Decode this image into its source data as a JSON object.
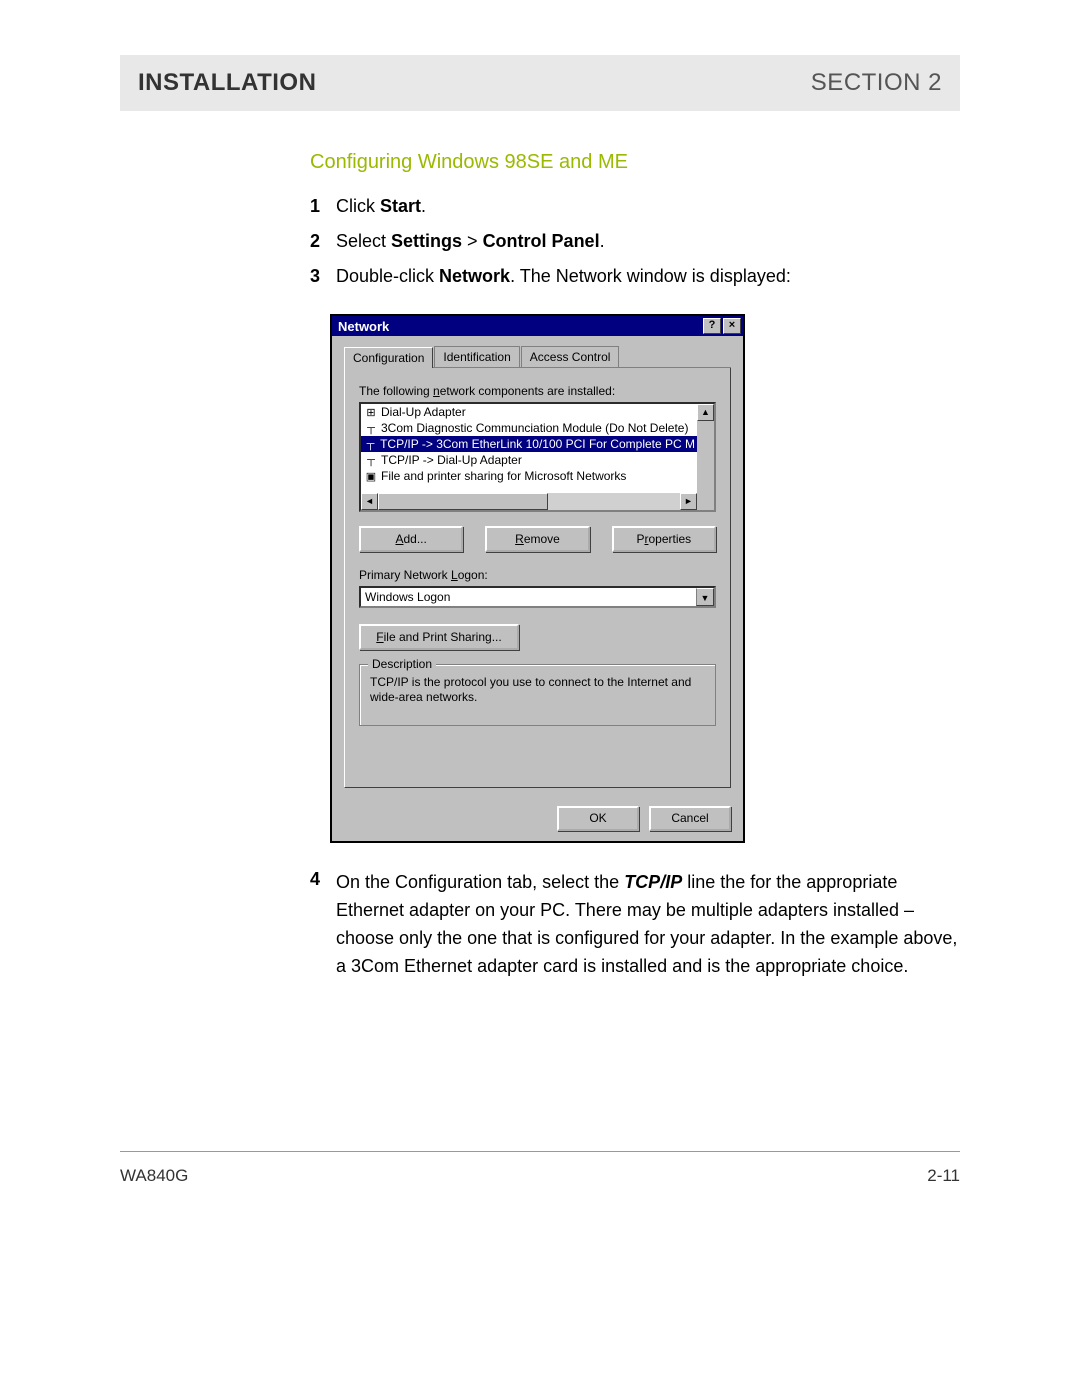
{
  "header": {
    "left": "INSTALLATION",
    "right": "SECTION 2"
  },
  "subheading": "Configuring Windows 98SE and ME",
  "steps": {
    "s1_num": "1",
    "s1_a": "Click ",
    "s1_b": "Start",
    "s1_c": ".",
    "s2_num": "2",
    "s2_a": "Select ",
    "s2_b": "Settings",
    "s2_c": " > ",
    "s2_d": "Control Panel",
    "s2_e": ".",
    "s3_num": "3",
    "s3_a": "Double-click ",
    "s3_b": "Network",
    "s3_c": ". The Network window is displayed:"
  },
  "dialog": {
    "title": "Network",
    "help_btn": "?",
    "close_btn": "×",
    "tabs": {
      "t1": "Configuration",
      "t2": "Identification",
      "t3": "Access Control"
    },
    "components_label_a": "The following ",
    "components_label_u": "n",
    "components_label_b": "etwork components are installed:",
    "list": {
      "i0": "Dial-Up Adapter",
      "i1": "3Com Diagnostic Communciation Module (Do Not Delete)",
      "i2": "TCP/IP -> 3Com EtherLink 10/100 PCI For Complete PC M",
      "i3": "TCP/IP -> Dial-Up Adapter",
      "i4": "File and printer sharing for Microsoft Networks"
    },
    "buttons": {
      "add_u": "A",
      "add_rest": "dd...",
      "remove_u": "R",
      "remove_rest": "emove",
      "props_pre": "P",
      "props_u": "r",
      "props_rest": "operties"
    },
    "logon_label_a": "Primary Network ",
    "logon_label_u": "L",
    "logon_label_b": "ogon:",
    "logon_value": "Windows Logon",
    "fps_u": "F",
    "fps_rest": "ile and Print Sharing...",
    "group_legend": "Description",
    "description": "TCP/IP is the protocol you use to connect to the Internet and wide-area networks.",
    "ok": "OK",
    "cancel": "Cancel"
  },
  "step4": {
    "num": "4",
    "a": "On the Configuration tab, select the ",
    "b": "TCP/IP",
    "c": " line the for the appropriate Ethernet adapter on your PC. There may be multiple adapters installed – choose only the one that is configured for your adapter. In the example above, a 3Com Ethernet adapter card is installed and is the appropriate choice."
  },
  "footer": {
    "model": "WA840G",
    "page": "2-11"
  }
}
